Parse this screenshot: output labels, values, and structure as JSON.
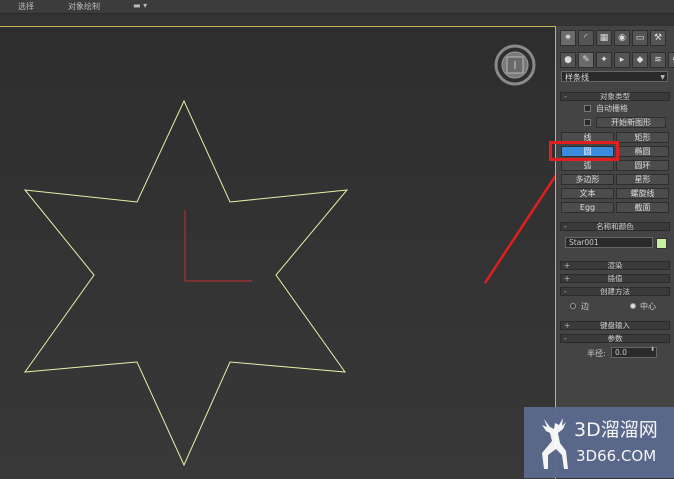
{
  "menubar": {
    "item_select": "选择",
    "item_object_paint": "对象绘制"
  },
  "panel": {
    "dropdown_value": "样条线",
    "object_type": {
      "title": "对象类型",
      "auto_grid": "自动栅格",
      "start_new_shape": "开始新图形",
      "buttons": [
        "线",
        "矩形",
        "圆",
        "椭圆",
        "弧",
        "圆环",
        "多边形",
        "星形",
        "文本",
        "螺旋线",
        "Egg",
        "截面"
      ],
      "active_button": "圆"
    },
    "name_color": {
      "title": "名称和颜色",
      "name_value": "Star001",
      "color": "#c8f0a0"
    },
    "rendering": "渲染",
    "interpolation": "插值",
    "creation_method": {
      "title": "创建方法",
      "option_edge": "边",
      "option_center": "中心",
      "selected": "中心"
    },
    "keyboard_entry": "键盘输入",
    "parameters": {
      "title": "参数",
      "radius_label": "半径:",
      "radius_value": "0.0"
    }
  },
  "watermark": {
    "brand": "3D溜溜网",
    "url": "3D66.COM"
  },
  "colors": {
    "star_outline": "#e6f0a8",
    "highlight_box": "#e02020",
    "arrow": "#e02020",
    "active_button": "#3a8bdc"
  }
}
